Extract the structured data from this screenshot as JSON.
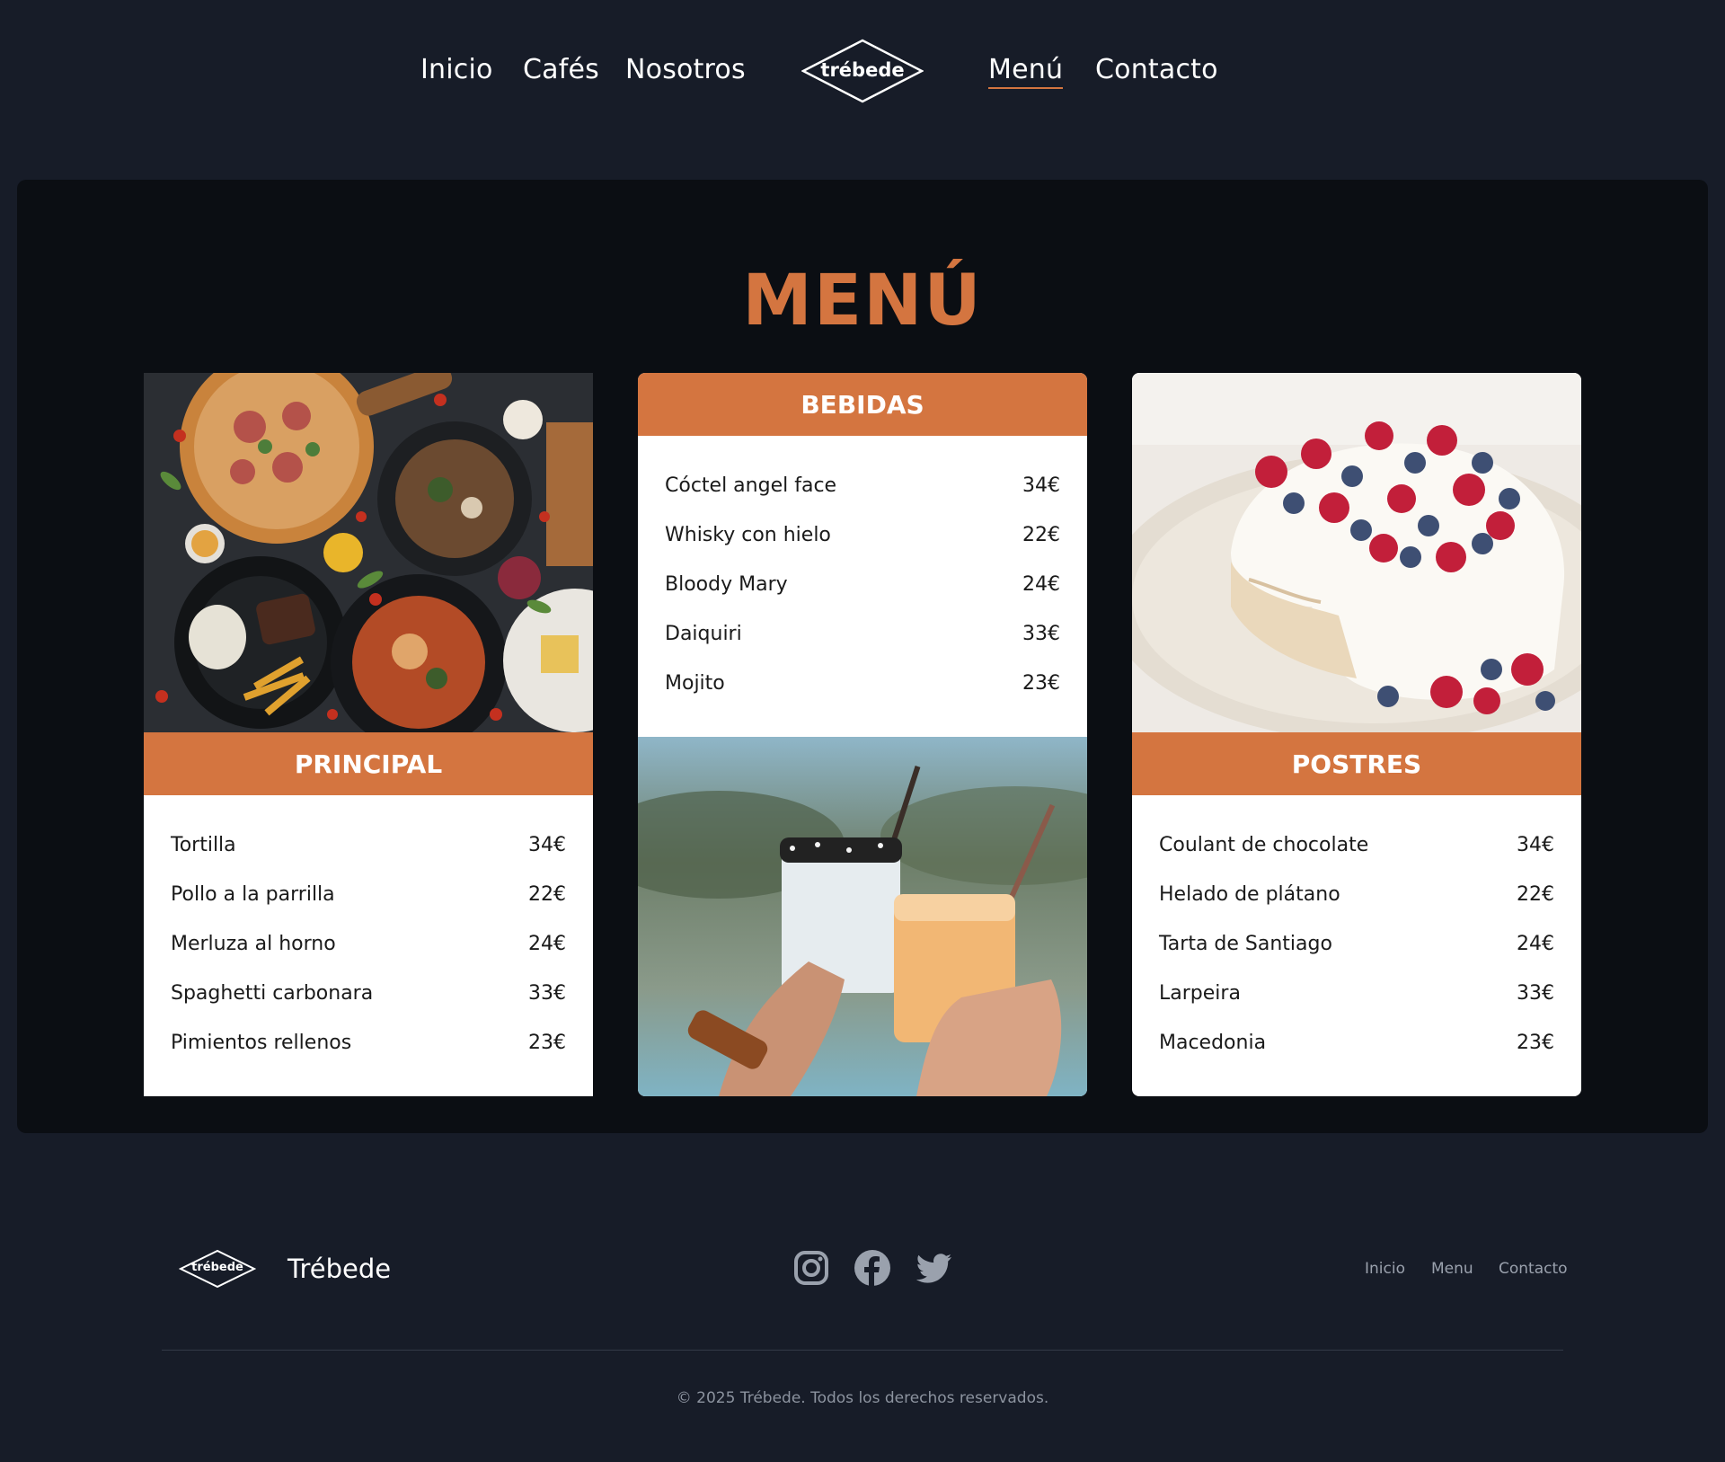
{
  "nav": {
    "links": [
      {
        "label": "Inicio"
      },
      {
        "label": "Cafés"
      },
      {
        "label": "Nosotros"
      },
      {
        "label": "Menú"
      },
      {
        "label": "Contacto"
      }
    ],
    "active": "Menú",
    "logo_text": "trébede"
  },
  "menu": {
    "title": "MENÚ",
    "sections": [
      {
        "heading": "PRINCIPAL",
        "image": "food-platter-photo",
        "items": [
          {
            "name": "Tortilla",
            "price": "34€"
          },
          {
            "name": "Pollo a la parrilla",
            "price": "22€"
          },
          {
            "name": "Merluza al horno",
            "price": "24€"
          },
          {
            "name": "Spaghetti carbonara",
            "price": "33€"
          },
          {
            "name": "Pimientos rellenos",
            "price": "23€"
          }
        ]
      },
      {
        "heading": "BEBIDAS",
        "image": "cocktails-toast-photo",
        "items": [
          {
            "name": "Cóctel angel face",
            "price": "34€"
          },
          {
            "name": "Whisky con hielo",
            "price": "22€"
          },
          {
            "name": "Bloody Mary",
            "price": "24€"
          },
          {
            "name": "Daiquiri",
            "price": "33€"
          },
          {
            "name": "Mojito",
            "price": "23€"
          }
        ]
      },
      {
        "heading": "POSTRES",
        "image": "berry-pavlova-photo",
        "items": [
          {
            "name": "Coulant de chocolate",
            "price": "34€"
          },
          {
            "name": "Helado de plátano",
            "price": "22€"
          },
          {
            "name": "Tarta de Santiago",
            "price": "24€"
          },
          {
            "name": "Larpeira",
            "price": "33€"
          },
          {
            "name": "Macedonia",
            "price": "23€"
          }
        ]
      }
    ]
  },
  "footer": {
    "brand": "Trébede",
    "logo_text": "trébede",
    "social": [
      "instagram-icon",
      "facebook-icon",
      "twitter-icon"
    ],
    "links": [
      {
        "label": "Inicio"
      },
      {
        "label": "Menu"
      },
      {
        "label": "Contacto"
      }
    ],
    "copyright": "© 2025 Trébede. Todos los derechos reservados."
  },
  "colors": {
    "background": "#171c28",
    "panel": "#0b0e13",
    "accent": "#d47540",
    "card": "#ffffff"
  }
}
